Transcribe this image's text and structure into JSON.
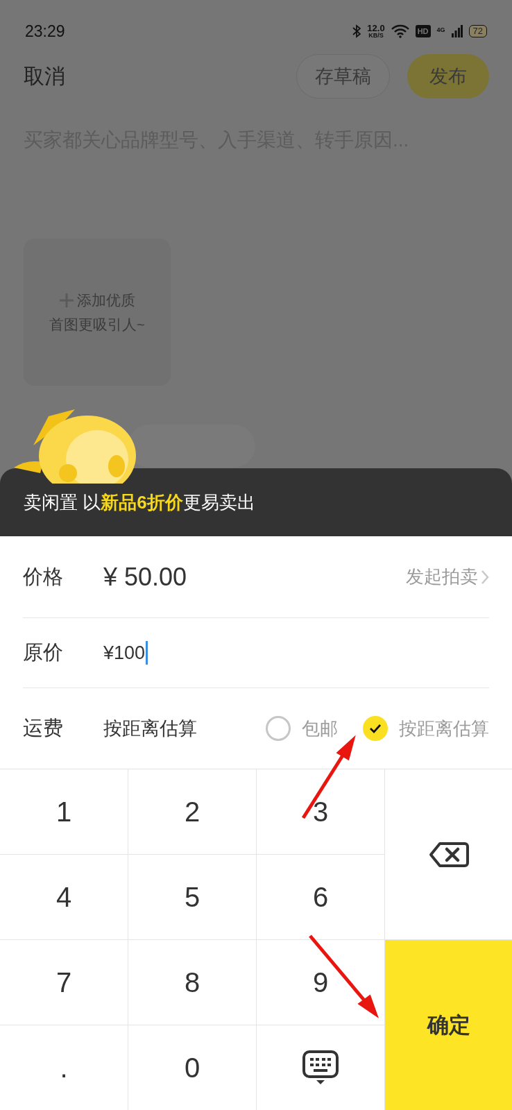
{
  "status_bar": {
    "time": "23:29",
    "net_speed": "12.0",
    "net_unit": "KB/S",
    "hd": "HD",
    "network": "4G",
    "battery": "72"
  },
  "header": {
    "cancel": "取消",
    "draft": "存草稿",
    "publish": "发布"
  },
  "description": {
    "placeholder": "买家都关心品牌型号、入手渠道、转手原因..."
  },
  "photo_tile": {
    "lines": [
      "添加优质",
      "首图更吸引人~"
    ]
  },
  "promo": "卖闲置 以**新品6折价**更易卖出",
  "fields": [
    {
      "label": "价格",
      "value": "¥ 50.00",
      "action": "发起拍卖",
      "focused": false
    },
    {
      "label": "原价",
      "value": "¥100",
      "focused": true
    }
  ],
  "shipping": {
    "label": "运费",
    "value": "按距离估算",
    "options": [
      {
        "label": "包邮",
        "selected": false
      },
      {
        "label": "按距离估算",
        "selected": true
      }
    ]
  },
  "keypad": [
    {
      "kind": "digit",
      "label": "1"
    },
    {
      "kind": "digit",
      "label": "2"
    },
    {
      "kind": "digit",
      "label": "3"
    },
    {
      "kind": "backspace"
    },
    {
      "kind": "digit",
      "label": "4"
    },
    {
      "kind": "digit",
      "label": "5"
    },
    {
      "kind": "digit",
      "label": "6"
    },
    {
      "kind": "digit",
      "label": "7"
    },
    {
      "kind": "digit",
      "label": "8"
    },
    {
      "kind": "digit",
      "label": "9"
    },
    {
      "kind": "confirm",
      "label": "确定"
    },
    {
      "kind": "digit",
      "label": "."
    },
    {
      "kind": "digit",
      "label": "0"
    },
    {
      "kind": "keyboard"
    }
  ]
}
